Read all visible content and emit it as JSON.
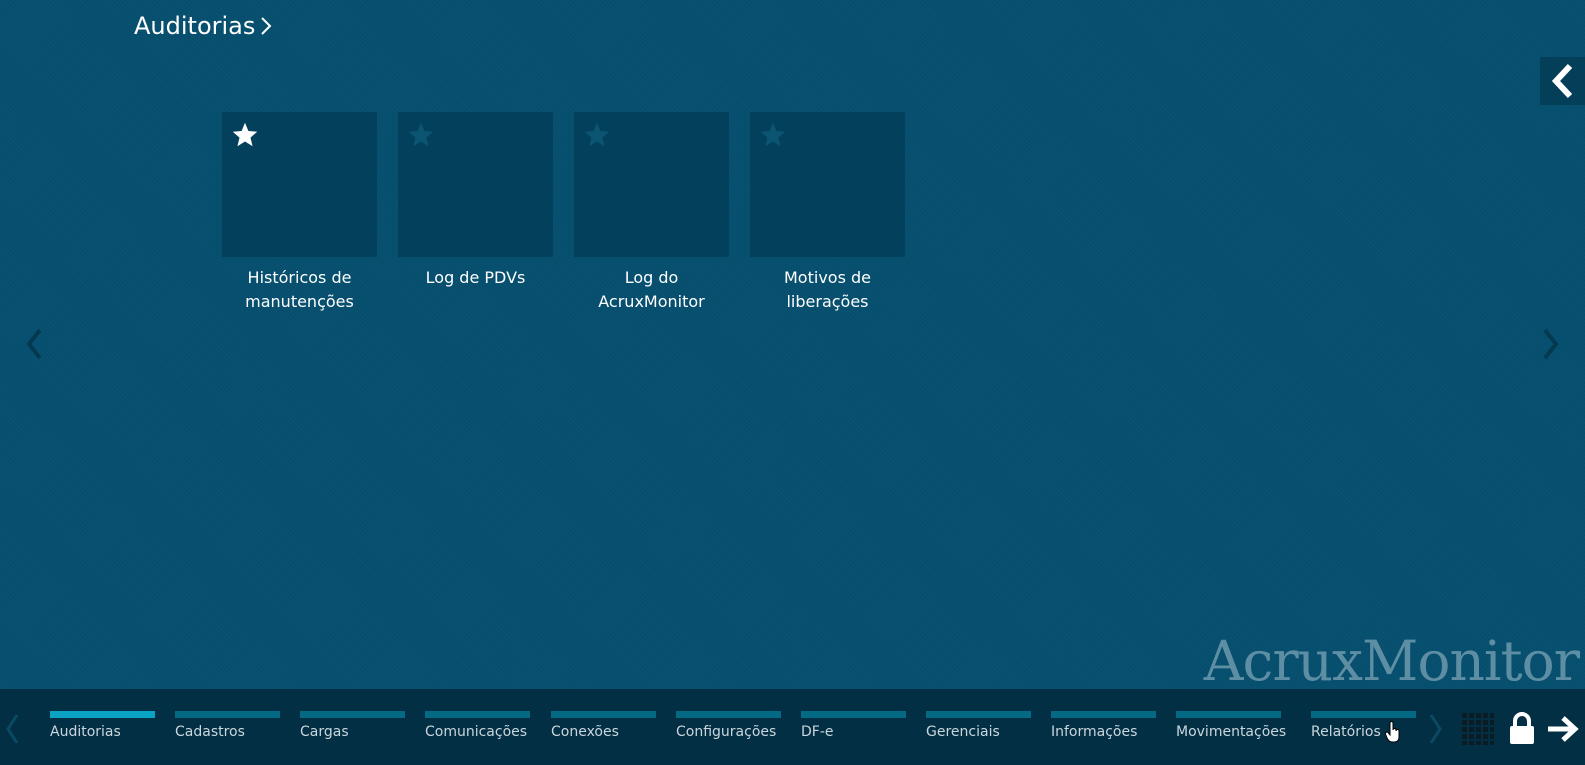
{
  "breadcrumb": {
    "title": "Auditorias"
  },
  "tiles": [
    {
      "label": "Históricos de manutenções",
      "favorite": true
    },
    {
      "label": "Log de PDVs",
      "favorite": false
    },
    {
      "label": "Log do AcruxMonitor",
      "favorite": false
    },
    {
      "label": "Motivos de liberações",
      "favorite": false
    }
  ],
  "brand": {
    "text": "AcruxMonitor"
  },
  "bottom_nav": {
    "categories": [
      {
        "label": "Auditorias",
        "active": true
      },
      {
        "label": "Cadastros",
        "active": false
      },
      {
        "label": "Cargas",
        "active": false
      },
      {
        "label": "Comunicações",
        "active": false
      },
      {
        "label": "Conexões",
        "active": false
      },
      {
        "label": "Configurações",
        "active": false
      },
      {
        "label": "DF-e",
        "active": false
      },
      {
        "label": "Gerenciais",
        "active": false
      },
      {
        "label": "Informações",
        "active": false
      },
      {
        "label": "Movimentações",
        "active": false
      },
      {
        "label": "Relatórios",
        "active": false
      }
    ]
  },
  "icons": {
    "collapse": "chevron-left-icon",
    "page_prev": "chevron-left-icon",
    "page_next": "chevron-right-icon",
    "grid": "grid-icon",
    "lock": "lock-icon",
    "exit": "arrow-right-icon",
    "favorite": "star-icon"
  },
  "colors": {
    "background": "#064f6f",
    "tile": "#03405b",
    "bottom_bar": "#032f44",
    "active_bar": "#0aa3c4",
    "inactive_bar": "#046a83",
    "brand_text": "#5e8ea3"
  }
}
